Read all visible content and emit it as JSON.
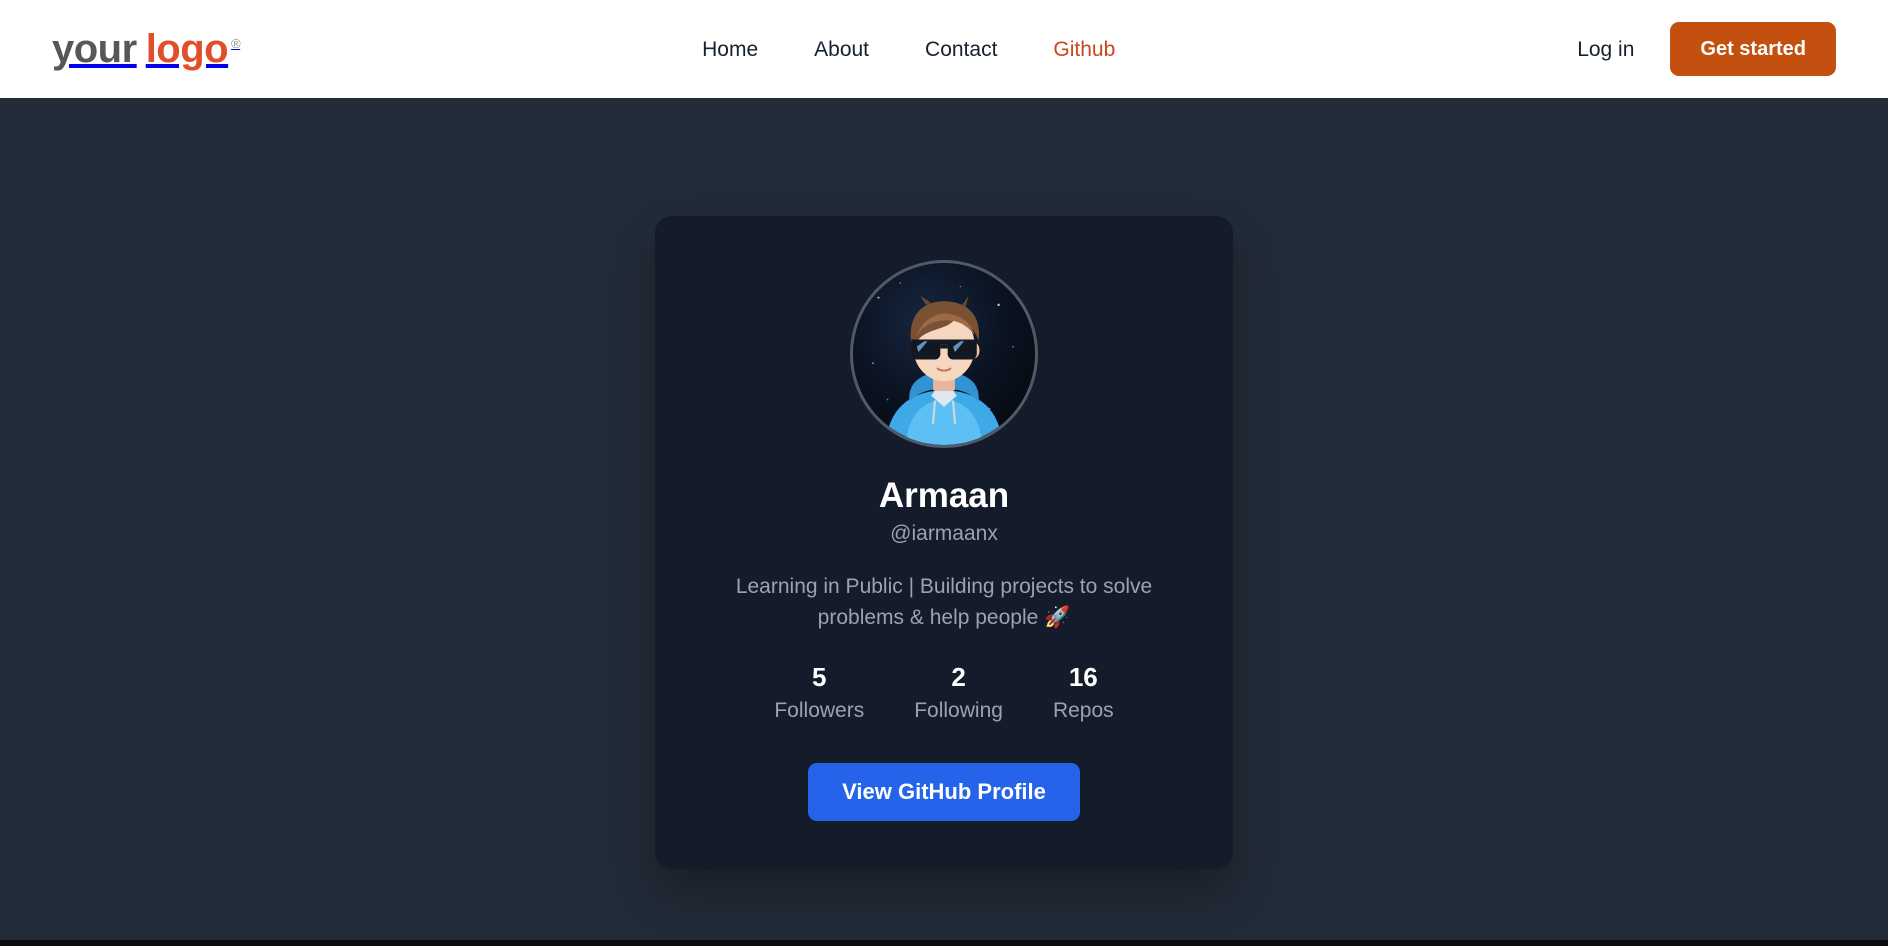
{
  "navbar": {
    "logo": {
      "part_one": "your",
      "part_two": "logo",
      "trademark": "®"
    },
    "links": [
      {
        "label": "Home",
        "active": false
      },
      {
        "label": "About",
        "active": false
      },
      {
        "label": "Contact",
        "active": false
      },
      {
        "label": "Github",
        "active": true
      }
    ],
    "login_label": "Log in",
    "cta_label": "Get started",
    "colors": {
      "background": "#ffffff",
      "link": "#16212e",
      "active_link": "#c8481c",
      "cta_background": "#c4500f",
      "logo_dark": "#555759",
      "logo_accent": "#e04e2a"
    }
  },
  "hero": {
    "background_color": "#222b38",
    "card": {
      "background_color": "#141b2a",
      "avatar": {
        "alt": "Cartoon avatar of a person with brown hair, black sunglasses and a light blue hoodie on a starry night background",
        "border_color": "#525a68"
      },
      "display_name": "Armaan",
      "username": "@iarmaanx",
      "bio": "Learning in Public | Building projects to solve problems & help people 🚀",
      "stats": [
        {
          "value": "5",
          "label": "Followers"
        },
        {
          "value": "2",
          "label": "Following"
        },
        {
          "value": "16",
          "label": "Repos"
        }
      ],
      "button_label": "View GitHub Profile",
      "button_color": "#2563eb"
    }
  }
}
